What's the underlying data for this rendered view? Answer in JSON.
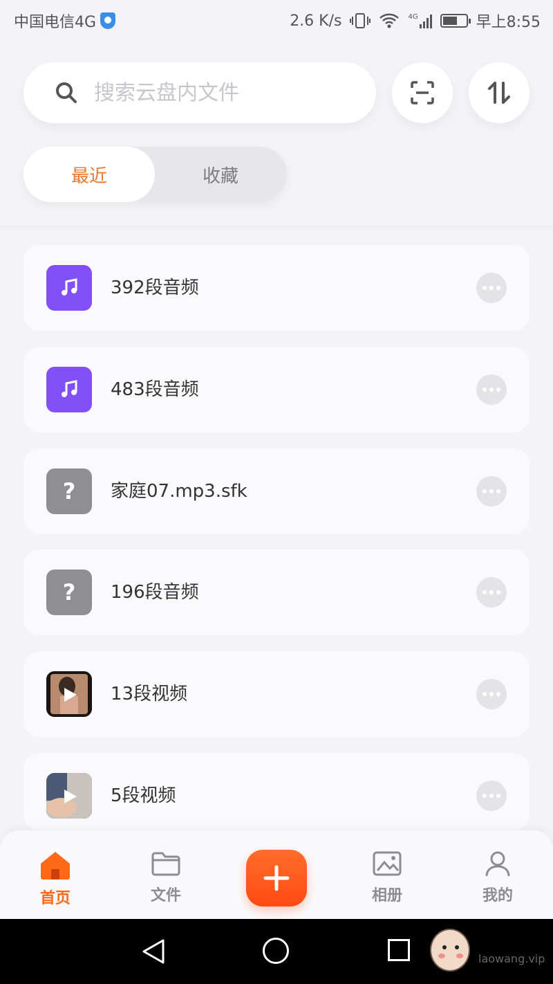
{
  "status_bar": {
    "carrier": "中国电信4G",
    "speed": "2.6 K/s",
    "network": "4G",
    "time": "早上8:55"
  },
  "search": {
    "placeholder": "搜索云盘内文件"
  },
  "header_buttons": {
    "scan_icon": "scan-icon",
    "sort_icon": "sort-icon"
  },
  "segment": {
    "recent_label": "最近",
    "favorites_label": "收藏",
    "active": "recent"
  },
  "files": [
    {
      "name": "392段音频",
      "type": "audio",
      "icon": "music-note-icon"
    },
    {
      "name": "483段音频",
      "type": "audio",
      "icon": "music-note-icon"
    },
    {
      "name": "家庭07.mp3.sfk",
      "type": "unknown",
      "icon": "question-mark-icon",
      "glyph": "?"
    },
    {
      "name": "196段音频",
      "type": "unknown",
      "icon": "question-mark-icon",
      "glyph": "?"
    },
    {
      "name": "13段视频",
      "type": "video",
      "icon": "play-icon"
    },
    {
      "name": "5段视频",
      "type": "video",
      "icon": "play-icon"
    }
  ],
  "tabbar": {
    "home": "首页",
    "files": "文件",
    "album": "相册",
    "mine": "我的",
    "active": "home"
  },
  "colors": {
    "accent": "#ff6a1a",
    "audio_icon_bg": "#8250f6",
    "unknown_icon_bg": "#8e8e93",
    "segment_active_text": "#e9772c"
  },
  "watermark": {
    "text": "laowang.vip"
  }
}
